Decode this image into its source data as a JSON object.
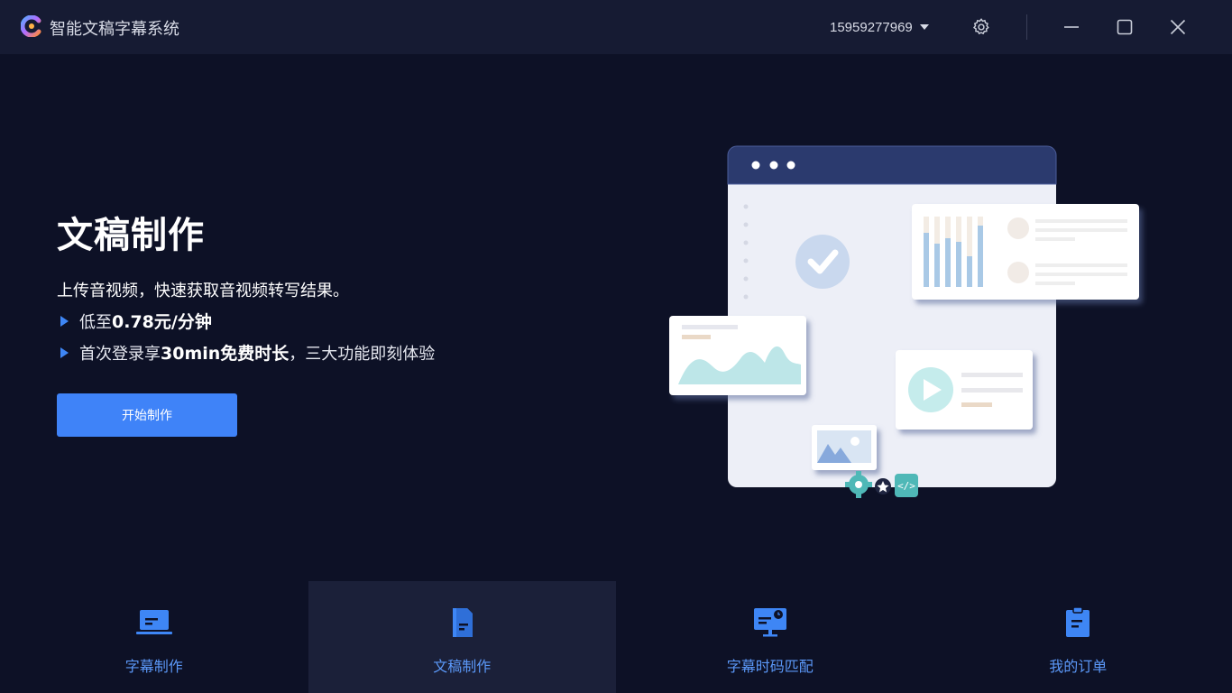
{
  "app": {
    "title": "智能文稿字幕系统"
  },
  "account": {
    "phone": "15959277969"
  },
  "window_controls": {
    "settings": "gear-icon",
    "minimize": "minimize-icon",
    "maximize": "maximize-icon",
    "close": "close-icon"
  },
  "hero": {
    "title": "文稿制作",
    "description": "上传音视频，快速获取音视频转写结果。",
    "bullet1_prefix": "低至",
    "bullet1_emph": "0.78元/分钟",
    "bullet2_prefix": "首次登录享",
    "bullet2_emph": "30min免费时长",
    "bullet2_suffix": "，三大功能即刻体验",
    "start_button": "开始制作"
  },
  "nav": {
    "items": [
      {
        "label": "字幕制作",
        "icon": "laptop-icon",
        "active": false
      },
      {
        "label": "文稿制作",
        "icon": "document-icon",
        "active": true
      },
      {
        "label": "字幕时码匹配",
        "icon": "monitor-clock-icon",
        "active": false
      },
      {
        "label": "我的订单",
        "icon": "clipboard-icon",
        "active": false
      }
    ]
  },
  "colors": {
    "background": "#0d1126",
    "titlebar": "#161b33",
    "accent": "#3f83f8",
    "nav_label": "#5b98f8",
    "nav_active_bg": "#1b2039"
  }
}
